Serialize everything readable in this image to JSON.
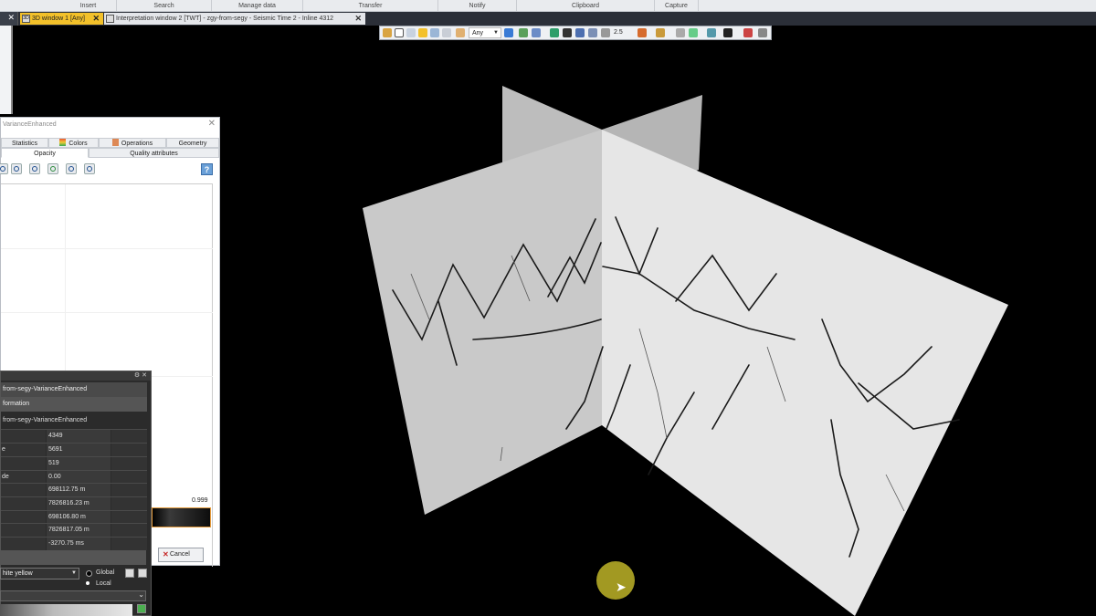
{
  "ribbon": {
    "groups": [
      "Insert",
      "Search",
      "Manage data",
      "Transfer",
      "Notify",
      "Clipboard",
      "Capture"
    ]
  },
  "tabs": {
    "active": {
      "label": "3D window 1 [Any]",
      "icon": "3D"
    },
    "inactive": {
      "label": "Interpretation window 2 [TWT] - zgy-from-segy - Seismic Time 2 - Inline 4312"
    }
  },
  "toolbar": {
    "domain_select": "Any",
    "zoom_value": "2.5"
  },
  "dialog": {
    "title": "VarianceEnhanced",
    "tabs_row1": [
      "Statistics",
      "Colors",
      "Operations",
      "Geometry"
    ],
    "tabs_row2": [
      "Opacity",
      "Quality attributes"
    ],
    "max_value": "0.999",
    "cancel_label": "Cancel"
  },
  "info_panel": {
    "header": "from-segy-VarianceEnhanced",
    "section": "formation",
    "object_name": "from-segy-VarianceEnhanced",
    "rows": [
      {
        "key": "",
        "value": "4349"
      },
      {
        "key": "e",
        "value": "5691"
      },
      {
        "key": "",
        "value": "519"
      },
      {
        "key": "de",
        "value": "0.00"
      },
      {
        "key": "",
        "value": "698112.75 m"
      },
      {
        "key": "",
        "value": "7826816.23 m"
      },
      {
        "key": "",
        "value": "698106.80 m"
      },
      {
        "key": "",
        "value": "7826817.05 m"
      },
      {
        "key": "",
        "value": "-3270.75 ms"
      }
    ],
    "colormap": "hite yellow",
    "radio_global": "Global",
    "radio_local": "Local"
  },
  "colors": {
    "active_tab": "#f3c12a",
    "cursor_highlight": "#bfb428"
  }
}
